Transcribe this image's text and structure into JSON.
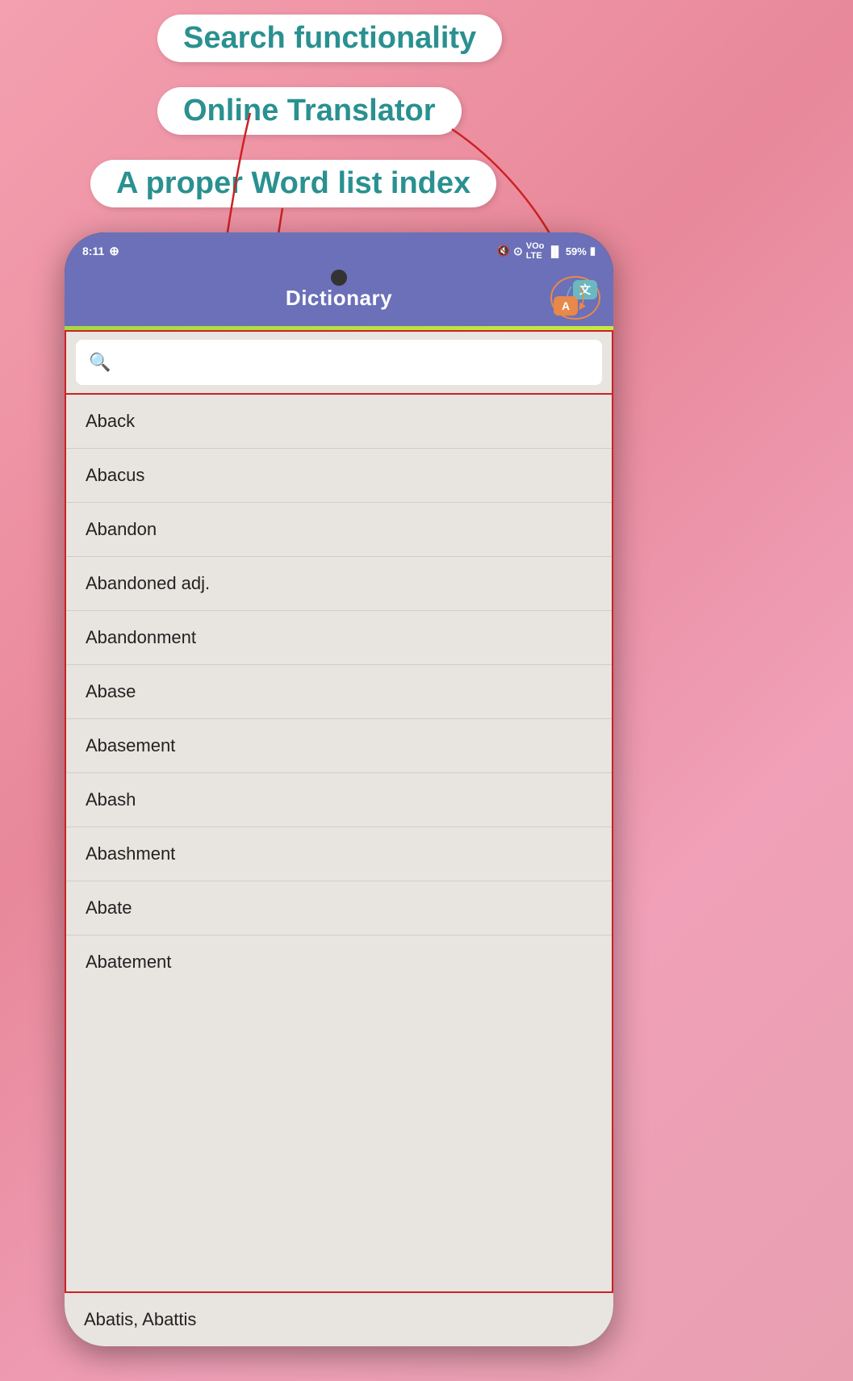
{
  "labels": {
    "search": "Search functionality",
    "translator": "Online Translator",
    "wordlist": "A proper Word list index"
  },
  "phone": {
    "status": {
      "time": "8:11",
      "whatsapp_icon": "⊕",
      "battery": "59%"
    },
    "header": {
      "title": "Dictionary",
      "translate_zh": "文",
      "translate_en": "A"
    },
    "search": {
      "placeholder": ""
    },
    "words": [
      "Aback",
      "Abacus",
      "Abandon",
      "Abandoned adj.",
      "Abandonment",
      "Abase",
      "Abasement",
      "Abash",
      "Abashment",
      "Abate",
      "Abatement"
    ],
    "partial_word": "Abatis, Abattis"
  },
  "colors": {
    "teal": "#2a9090",
    "header_bg": "#6b70b8",
    "list_bg": "#e8e4e0",
    "red_border": "#cc2222",
    "translate_orange": "#e8884a",
    "translate_teal": "#6bb8c0"
  }
}
